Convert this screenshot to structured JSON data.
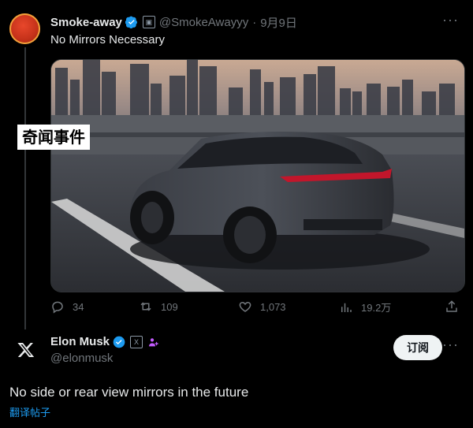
{
  "tweet1": {
    "name": "Smoke-away",
    "handle": "@SmokeAwayyy",
    "separator": "·",
    "date": "9月9日",
    "text": "No Mirrors Necessary",
    "media_watermark": "奇闻事件",
    "more_icon": "more-dots-icon",
    "actions": {
      "reply_count": "34",
      "retweet_count": "109",
      "like_count": "1,073",
      "views_count": "19.2万"
    }
  },
  "tweet2": {
    "name": "Elon Musk",
    "handle": "@elonmusk",
    "subscribe_label": "订阅",
    "text": "No side or rear view mirrors in the future",
    "translate_label": "翻译帖子"
  },
  "colors": {
    "background": "#000000",
    "text_primary": "#e7e9ea",
    "text_secondary": "#71767b",
    "accent": "#1d9bf0"
  }
}
